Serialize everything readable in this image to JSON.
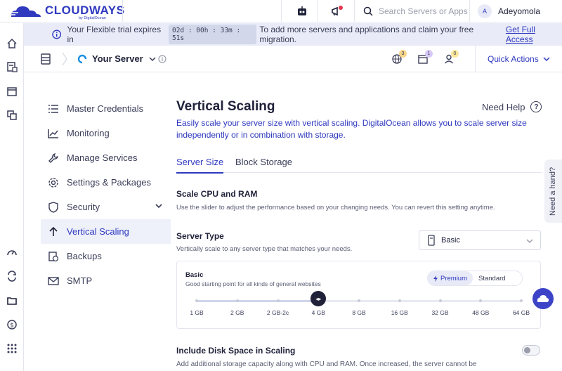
{
  "topbar": {
    "brand": "CLOUDWAYS",
    "brand_sub": "by DigitalOcean",
    "search_placeholder": "Search Servers or Apps",
    "user_initial": "A",
    "user_name": "Adeyomola"
  },
  "banner": {
    "text_before": "Your Flexible trial expires in",
    "timer": "02d : 00h : 33m : 51s",
    "text_after": "To add more servers and applications and claim your free migration.",
    "link": "Get Full Access"
  },
  "serverbar": {
    "server_name": "Your Server",
    "badges": [
      "3",
      "1",
      "0"
    ],
    "quick_actions": "Quick Actions"
  },
  "menu": {
    "items": [
      {
        "label": "Master Credentials",
        "icon": "list-icon"
      },
      {
        "label": "Monitoring",
        "icon": "chart-icon"
      },
      {
        "label": "Manage Services",
        "icon": "wrench-icon"
      },
      {
        "label": "Settings & Packages",
        "icon": "gear-icon"
      },
      {
        "label": "Security",
        "icon": "shield-icon"
      },
      {
        "label": "Vertical Scaling",
        "icon": "arrow-up-icon",
        "active": true
      },
      {
        "label": "Backups",
        "icon": "backup-icon"
      },
      {
        "label": "SMTP",
        "icon": "mail-icon"
      }
    ]
  },
  "main": {
    "title": "Vertical Scaling",
    "help": "Need Help",
    "help_icon": "?",
    "description": "Easily scale your server size with vertical scaling. DigitalOcean allows you to scale server size independently or in combination with storage.",
    "tabs": [
      "Server Size",
      "Block Storage"
    ],
    "scale_title": "Scale CPU and RAM",
    "scale_text": "Use the slider to adjust the performance based on your changing needs. You can revert this setting anytime.",
    "server_type_title": "Server Type",
    "server_type_text": "Vertically scale to any server type that matches your needs.",
    "server_type_value": "Basic",
    "card": {
      "title": "Basic",
      "subtitle": "Good starting point for all kinds of general websites",
      "options": [
        "Premium",
        "Standard"
      ],
      "selected_option": "Premium",
      "sizes": [
        "1 GB",
        "2 GB",
        "2 GB-2c",
        "4 GB",
        "8 GB",
        "16 GB",
        "32 GB",
        "48 GB",
        "64 GB"
      ],
      "selected_size": "4 GB",
      "thumb_glyph": "◂▸"
    },
    "disk_title": "Include Disk Space in Scaling",
    "disk_text": "Add additional storage capacity along with CPU and RAM. Once increased, the server cannot be",
    "disk_enabled": false
  },
  "need_hand": "Need a hand?",
  "colors": {
    "accent": "#2f39bf",
    "banner": "#e9ecf8",
    "text": "#20223a"
  }
}
